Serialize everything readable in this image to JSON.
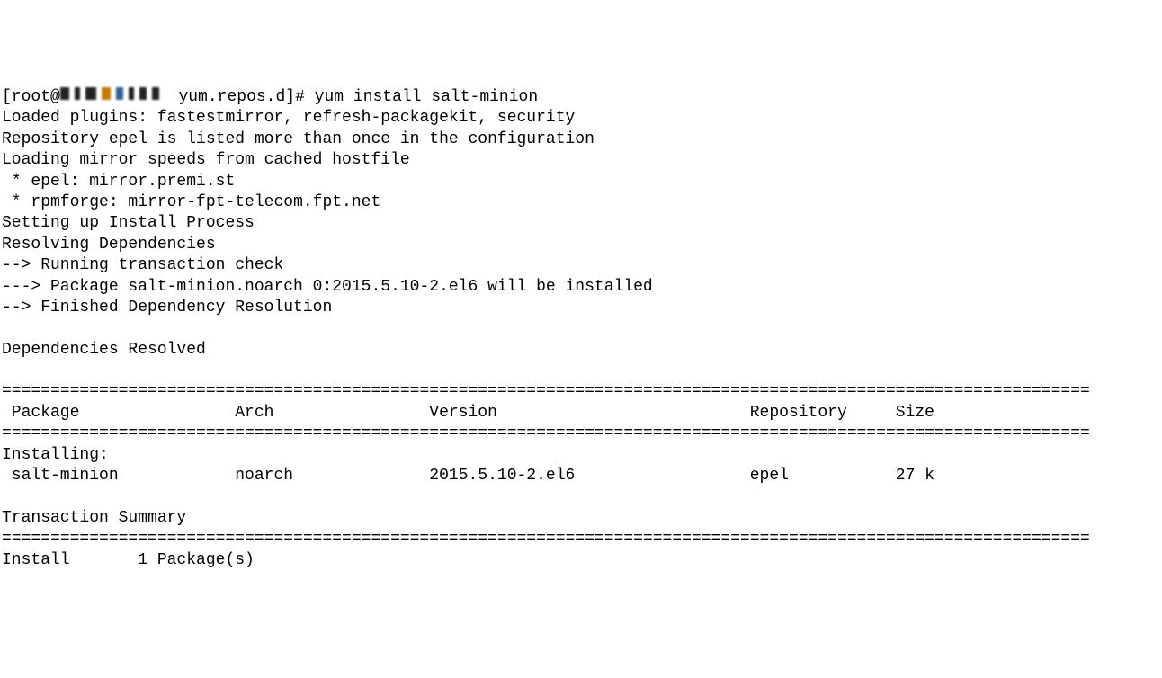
{
  "prompt": {
    "user": "root",
    "cwd": "yum.repos.d",
    "command": "yum install salt-minion"
  },
  "output": {
    "l1": "Loaded plugins: fastestmirror, refresh-packagekit, security",
    "l2": "Repository epel is listed more than once in the configuration",
    "l3": "Loading mirror speeds from cached hostfile",
    "l4": " * epel: mirror.premi.st",
    "l5": " * rpmforge: mirror-fpt-telecom.fpt.net",
    "l6": "Setting up Install Process",
    "l7": "Resolving Dependencies",
    "l8": "--> Running transaction check",
    "l9": "---> Package salt-minion.noarch 0:2015.5.10-2.el6 will be installed",
    "l10": "--> Finished Dependency Resolution",
    "l11": "",
    "l12": "Dependencies Resolved",
    "l13": "",
    "sep": "================================================================================================================",
    "header": " Package                Arch                Version                          Repository     Size",
    "installing": "Installing:",
    "pkgrow": " salt-minion            noarch              2015.5.10-2.el6                  epel           27 k",
    "blank": "",
    "tsummary": "Transaction Summary",
    "installline": "Install       1 Package(s)"
  },
  "chart_data": {
    "type": "table",
    "title": "Dependencies Resolved",
    "columns": [
      "Package",
      "Arch",
      "Version",
      "Repository",
      "Size"
    ],
    "rows": [
      [
        "salt-minion",
        "noarch",
        "2015.5.10-2.el6",
        "epel",
        "27 k"
      ]
    ],
    "summary": "Install 1 Package(s)"
  }
}
